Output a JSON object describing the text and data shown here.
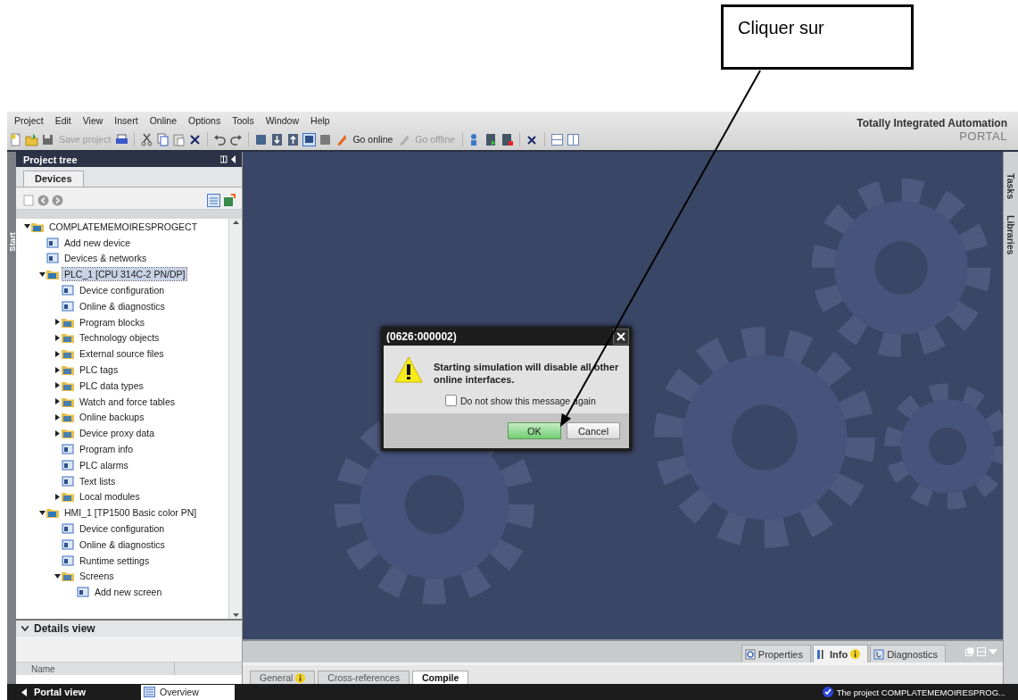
{
  "annotation": {
    "text": "Cliquer sur"
  },
  "menu": [
    "Project",
    "Edit",
    "View",
    "Insert",
    "Online",
    "Options",
    "Tools",
    "Window",
    "Help"
  ],
  "toolbar": [
    {
      "label": "Save project",
      "disabled": true
    },
    {
      "label": "Go online",
      "disabled": false
    },
    {
      "label": "Go offline",
      "disabled": true
    }
  ],
  "brand": {
    "title": "Totally Integrated Automation",
    "subtitle": "PORTAL"
  },
  "start_strip": {
    "label": "Start"
  },
  "project_tree": {
    "title": "Project tree",
    "tabs": [
      {
        "label": "Devices",
        "selected": true
      }
    ],
    "items": [
      {
        "label": "COMPLATEMEMOIRESPROGECT",
        "expanded": true,
        "selected": false,
        "children": [
          {
            "label": "Add new device",
            "selected": false
          },
          {
            "label": "Devices & networks",
            "selected": false
          },
          {
            "label": "PLC_1 [CPU 314C-2 PN/DP]",
            "expanded": true,
            "selected": true,
            "children": [
              {
                "label": "Device configuration",
                "selected": false
              },
              {
                "label": "Online & diagnostics",
                "selected": false
              },
              {
                "label": "Program blocks",
                "expanded": false,
                "selected": false
              },
              {
                "label": "Technology objects",
                "expanded": false,
                "selected": false
              },
              {
                "label": "External source files",
                "expanded": false,
                "selected": false
              },
              {
                "label": "PLC tags",
                "expanded": false,
                "selected": false
              },
              {
                "label": "PLC data types",
                "expanded": false,
                "selected": false
              },
              {
                "label": "Watch and force tables",
                "expanded": false,
                "selected": false
              },
              {
                "label": "Online backups",
                "expanded": false,
                "selected": false
              },
              {
                "label": "Device proxy data",
                "expanded": false,
                "selected": false
              },
              {
                "label": "Program info",
                "selected": false
              },
              {
                "label": "PLC alarms",
                "selected": false
              },
              {
                "label": "Text lists",
                "selected": false
              },
              {
                "label": "Local modules",
                "expanded": false,
                "selected": false
              }
            ]
          },
          {
            "label": "HMI_1 [TP1500 Basic color PN]",
            "expanded": true,
            "selected": false,
            "children": [
              {
                "label": "Device configuration",
                "selected": false
              },
              {
                "label": "Online & diagnostics",
                "selected": false
              },
              {
                "label": "Runtime settings",
                "selected": false
              },
              {
                "label": "Screens",
                "expanded": true,
                "selected": false,
                "children": [
                  {
                    "label": "Add new screen",
                    "selected": false
                  }
                ]
              }
            ]
          }
        ]
      }
    ]
  },
  "details_view": {
    "title": "Details view",
    "expanded": true,
    "columns": [
      "Name"
    ]
  },
  "dialog": {
    "title": "(0626:000002)",
    "message": "Starting simulation will disable all other online interfaces.",
    "checkbox": {
      "label": "Do not show this message again",
      "checked": false
    },
    "buttons": [
      {
        "label": "OK",
        "default": true
      },
      {
        "label": "Cancel",
        "default": false
      }
    ]
  },
  "right_tabs": [
    {
      "label": "Tasks",
      "selected": false
    },
    {
      "label": "Libraries",
      "selected": false
    }
  ],
  "inspector": {
    "tabs": [
      {
        "label": "Properties",
        "selected": false,
        "info": false
      },
      {
        "label": "Info",
        "selected": true,
        "info": true
      },
      {
        "label": "Diagnostics",
        "selected": false,
        "info": false
      }
    ],
    "subtabs": [
      {
        "label": "General",
        "selected": false,
        "info": true
      },
      {
        "label": "Cross-references",
        "selected": false,
        "info": false
      },
      {
        "label": "Compile",
        "selected": true,
        "info": false
      }
    ]
  },
  "status_bar": {
    "portal_view": "Portal view",
    "overview": "Overview",
    "message": "The project COMPLATEMEMOIRESPROG..."
  }
}
